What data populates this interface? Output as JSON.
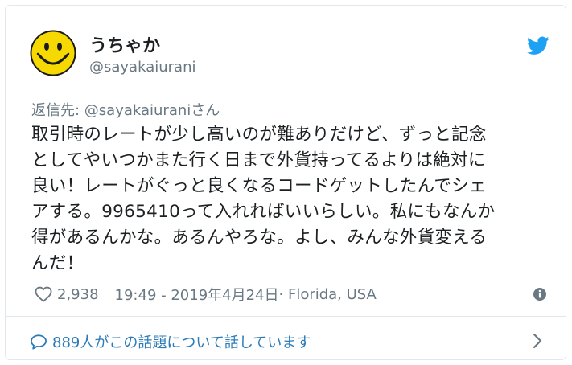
{
  "author": {
    "display_name": "うちゃか",
    "screen_name": "@sayakaiurani",
    "avatar_icon": "smiley-face-icon"
  },
  "platform_icon": "twitter-bird-icon",
  "reply": {
    "prefix": "返信先: ",
    "handle": "@sayakaiurani",
    "suffix": "さん"
  },
  "tweet": {
    "lines": [
      "取引時のレートが少し高いのが難ありだけど、ずっと記念",
      "としてやいつかまた行く日まで外貨持ってるよりは絶対に",
      "良い！レートがぐっと良くなるコードゲットしたんでシェ",
      "アする。9965410って入れればいいらしい。私にもなんか",
      "得があるんかな。あるんやろな。よし、みんな外貨変える",
      "んだ！"
    ]
  },
  "meta": {
    "likes": "2,938",
    "timestamp": "19:49 - 2019年4月24日",
    "location": " · Florida, USA"
  },
  "footer": {
    "conversation_text": "889人がこの話題について話しています"
  },
  "colors": {
    "twitter_blue": "#1da1f2",
    "link_blue": "#2b7bb9",
    "muted_gray": "#697882",
    "smiley_yellow": "#f6d900"
  }
}
